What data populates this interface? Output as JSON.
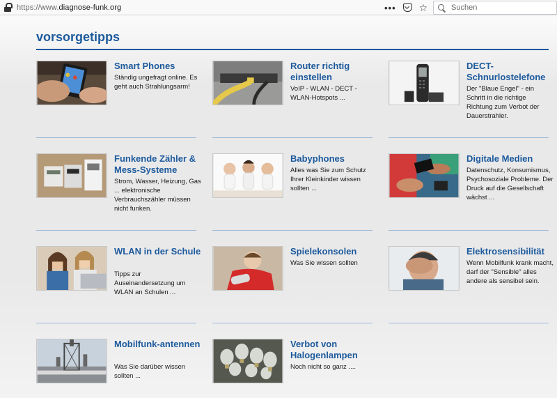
{
  "browser": {
    "url_prefix": "https://www.",
    "url_domain": "diagnose-funk.org",
    "page_actions_icon": "more-dots-icon",
    "search_placeholder": "Suchen"
  },
  "section": {
    "title": "vorsorgetipps"
  },
  "cards": [
    {
      "title": "Smart Phones",
      "desc": "Ständig ungefragt online. Es geht auch Strahlungsarm!",
      "image": "smartphone-hands-photo"
    },
    {
      "title": "Router richtig einstellen",
      "desc": "VoIP - WLAN - DECT - WLAN-Hotspots ...",
      "image": "router-cables-photo"
    },
    {
      "title": "DECT-Schnurlostelefone",
      "desc": "Der \"Blaue Engel\" - ein Schritt in die richtige Richtung zum Verbot der Dauerstrahler.",
      "image": "cordless-phone-photo"
    },
    {
      "title": "Funkende Zähler & Mess-Systeme",
      "desc": "Strom, Wasser, Heizung, Gas ... elektronische Verbrauchszähler müssen nicht funken.",
      "image": "electricity-meters-photo"
    },
    {
      "title": "Babyphones",
      "desc": "Alles was Sie zum Schutz Ihrer Kleinkinder wissen sollten ...",
      "image": "babies-photo"
    },
    {
      "title": "Digitale Medien",
      "desc": "Datenschutz, Konsumismus, Psychosoziale Probleme. Der Druck auf die Gesellschaft wächst ...",
      "image": "hands-devices-photo"
    },
    {
      "title": "WLAN in der Schule",
      "desc": "Tipps zur Auseinandersetzung um WLAN an Schulen ...",
      "image": "students-laptop-photo"
    },
    {
      "title": "Spielekonsolen",
      "desc": "Was Sie wissen sollten",
      "image": "child-gaming-photo"
    },
    {
      "title": "Elektrosensibilität",
      "desc": "Wenn Mobilfunk krank macht, darf der \"Sensible\" alles andere als sensibel sein.",
      "image": "headache-man-photo"
    },
    {
      "title": "Mobilfunk-antennen",
      "desc": "Was Sie darüber wissen sollten ...",
      "image": "antenna-tower-photo"
    },
    {
      "title": "Verbot von Halogenlampen",
      "desc": "Noch nicht so ganz ....",
      "image": "light-bulbs-photo"
    }
  ],
  "colors": {
    "accent": "#1d5a9c",
    "separator": "#9cb8d8"
  }
}
